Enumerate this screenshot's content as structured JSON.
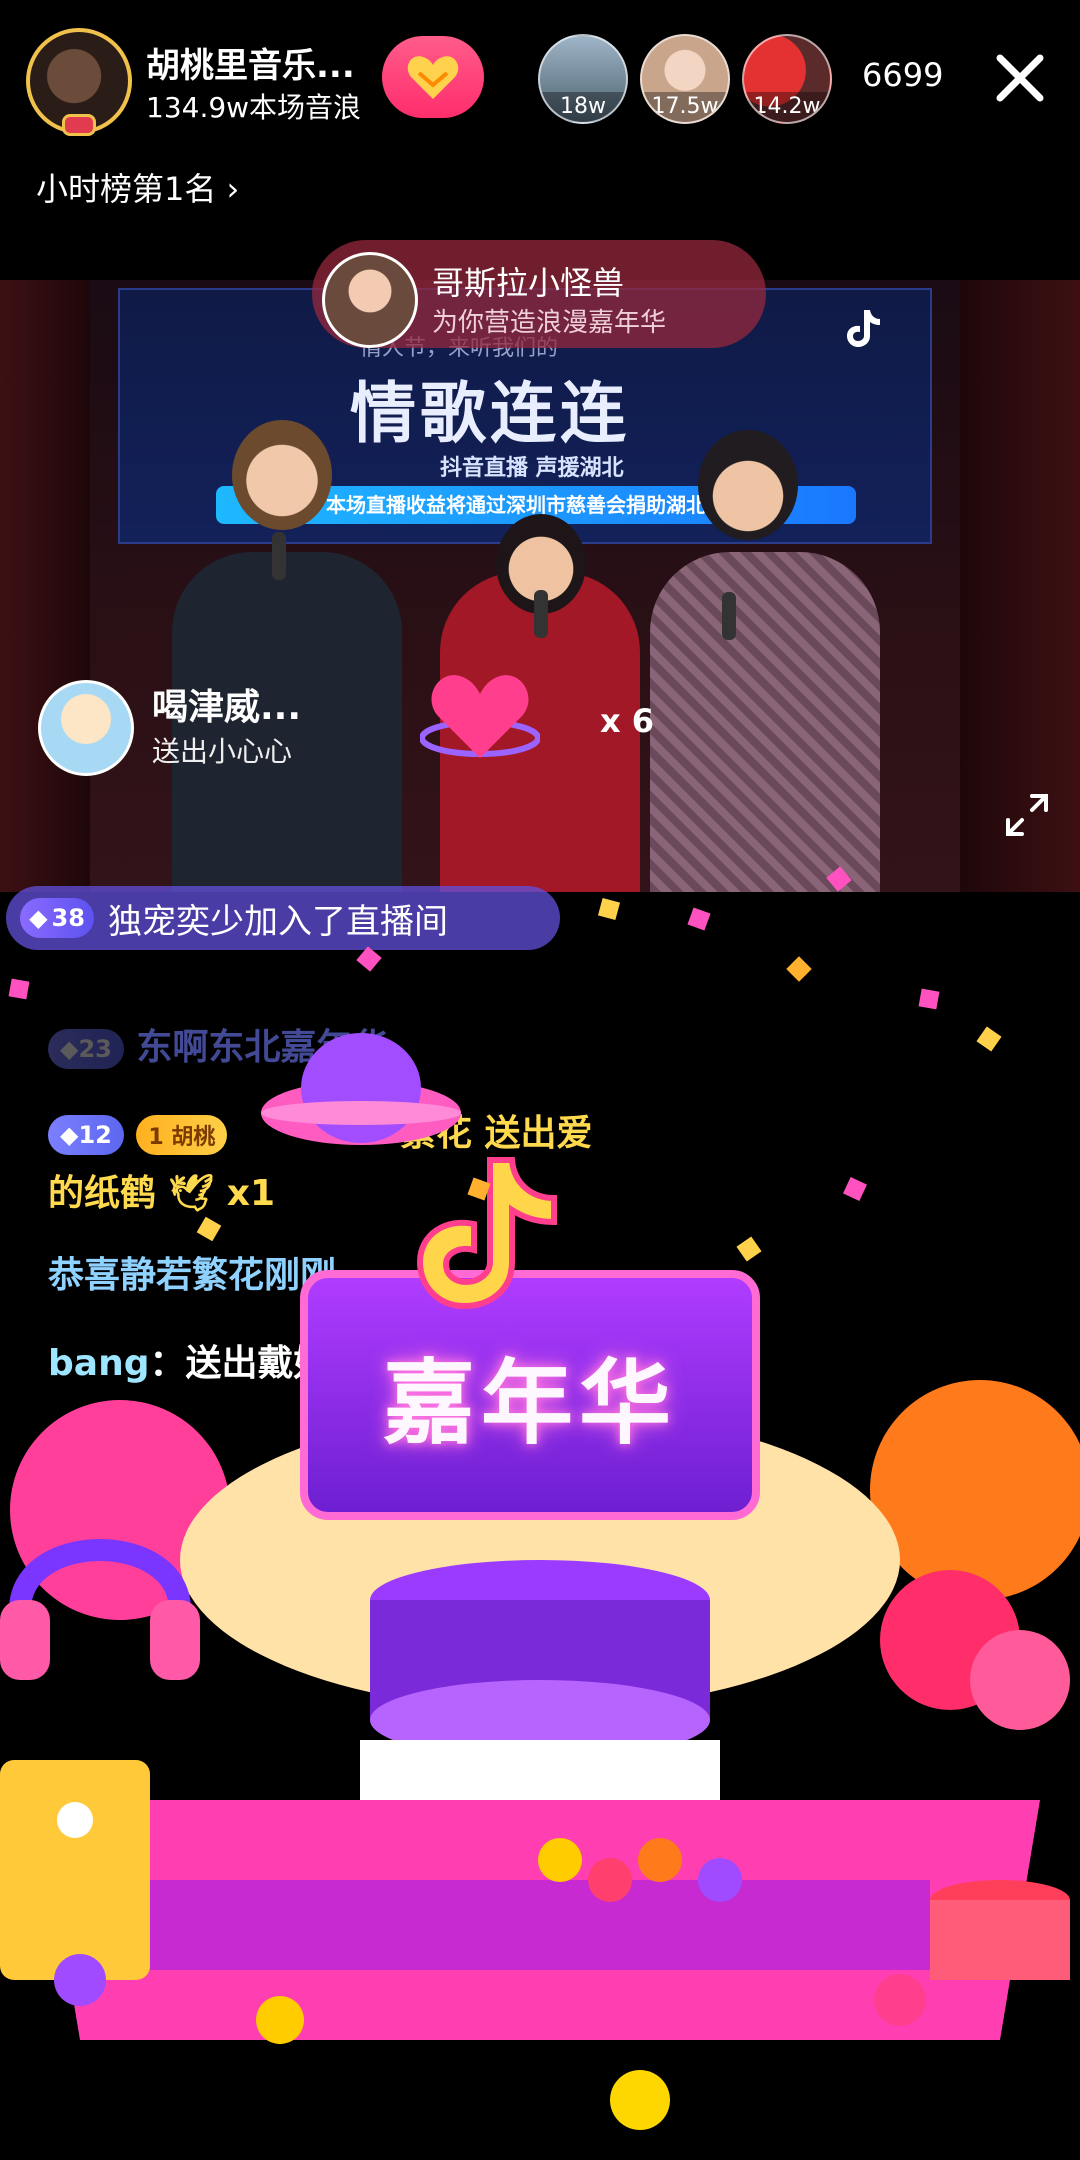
{
  "header": {
    "host_name": "胡桃里音乐...",
    "host_sub": "134.9w本场音浪",
    "viewers": [
      {
        "label": "18w"
      },
      {
        "label": "17.5w"
      },
      {
        "label": "14.2w"
      }
    ],
    "viewer_count": "6699",
    "rank_label": "小时榜第1名"
  },
  "stage": {
    "banner_top": "情人节，来听我们的",
    "banner_title": "情歌连连",
    "banner_sub": "抖音直播    声援湖北",
    "banner_strip": "本场直播收益将通过深圳市慈善会捐助湖北行动"
  },
  "gift": {
    "sender": "哥斯拉小怪兽",
    "desc": "为你营造浪漫嘉年华"
  },
  "small_gift": {
    "sender": "喝津威...",
    "desc": "送出小心心",
    "multiplier": "x 6"
  },
  "join": {
    "level": "38",
    "text": "独宠奕少加入了直播间"
  },
  "comments": [
    {
      "level": "23",
      "text": "东啊东北嘉年华"
    },
    {
      "level": "12",
      "fan": "1 胡桃",
      "text": "繁花  送出爱"
    },
    {
      "text": "的纸鹤 🕊  x1"
    },
    {
      "text": "恭喜静若繁花刚刚"
    },
    {
      "user": "bang",
      "text": "：送出戴好"
    }
  ],
  "scene": {
    "title": "嘉年华"
  },
  "colors": {
    "accent_pink": "#ff2d6c",
    "gold": "#ffd94e",
    "purple": "#8a6bff"
  }
}
